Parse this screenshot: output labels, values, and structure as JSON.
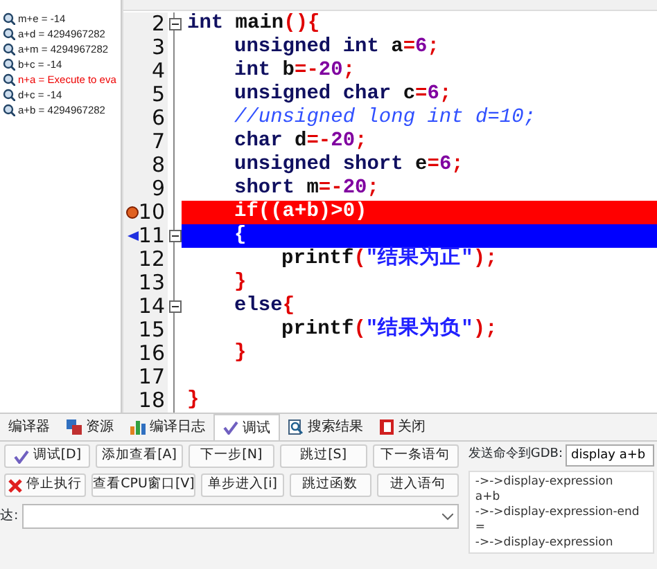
{
  "watches": [
    {
      "text": "m+e = -14",
      "error": false
    },
    {
      "text": "a+d = 4294967282",
      "error": false
    },
    {
      "text": "a+m = 4294967282",
      "error": false
    },
    {
      "text": "b+c = -14",
      "error": false
    },
    {
      "text": "n+a = Execute to eva",
      "error": true
    },
    {
      "text": "d+c = -14",
      "error": false
    },
    {
      "text": "a+b = 4294967282",
      "error": false
    }
  ],
  "editor": {
    "lines": [
      {
        "number": "2",
        "foldable": true,
        "breakpoint": false,
        "current": false,
        "tokens": [
          {
            "text": "int",
            "kind": "kw"
          },
          {
            "text": " main",
            "kind": "plain"
          },
          {
            "text": "(){",
            "kind": "sym"
          }
        ],
        "children": [
          {
            "number": "3",
            "foldable": false,
            "breakpoint": false,
            "current": false,
            "tokens": [
              {
                "text": "unsigned int",
                "kind": "kw"
              },
              {
                "text": " a",
                "kind": "plain"
              },
              {
                "text": "=",
                "kind": "sym"
              },
              {
                "text": "6",
                "kind": "num"
              },
              {
                "text": ";",
                "kind": "sym"
              }
            ]
          },
          {
            "number": "4",
            "foldable": false,
            "breakpoint": false,
            "current": false,
            "tokens": [
              {
                "text": "int",
                "kind": "kw"
              },
              {
                "text": " b",
                "kind": "plain"
              },
              {
                "text": "=-",
                "kind": "sym"
              },
              {
                "text": "20",
                "kind": "num"
              },
              {
                "text": ";",
                "kind": "sym"
              }
            ]
          },
          {
            "number": "5",
            "foldable": false,
            "breakpoint": false,
            "current": false,
            "tokens": [
              {
                "text": "unsigned char",
                "kind": "kw"
              },
              {
                "text": " c",
                "kind": "plain"
              },
              {
                "text": "=",
                "kind": "sym"
              },
              {
                "text": "6",
                "kind": "num"
              },
              {
                "text": ";",
                "kind": "sym"
              }
            ]
          },
          {
            "number": "6",
            "foldable": false,
            "breakpoint": false,
            "current": false,
            "tokens": [
              {
                "text": "//unsigned long int d=10;",
                "kind": "comment"
              }
            ]
          },
          {
            "number": "7",
            "foldable": false,
            "breakpoint": false,
            "current": false,
            "tokens": [
              {
                "text": "char",
                "kind": "kw"
              },
              {
                "text": " d",
                "kind": "plain"
              },
              {
                "text": "=-",
                "kind": "sym"
              },
              {
                "text": "20",
                "kind": "num"
              },
              {
                "text": ";",
                "kind": "sym"
              }
            ]
          },
          {
            "number": "8",
            "foldable": false,
            "breakpoint": false,
            "current": false,
            "tokens": [
              {
                "text": "unsigned short",
                "kind": "kw"
              },
              {
                "text": " e",
                "kind": "plain"
              },
              {
                "text": "=",
                "kind": "sym"
              },
              {
                "text": "6",
                "kind": "num"
              },
              {
                "text": ";",
                "kind": "sym"
              }
            ]
          },
          {
            "number": "9",
            "foldable": false,
            "breakpoint": false,
            "current": false,
            "tokens": [
              {
                "text": "short",
                "kind": "kw"
              },
              {
                "text": " m",
                "kind": "plain"
              },
              {
                "text": "=-",
                "kind": "sym"
              },
              {
                "text": "20",
                "kind": "num"
              },
              {
                "text": ";",
                "kind": "sym"
              }
            ]
          },
          {
            "number": "10",
            "foldable": false,
            "breakpoint": true,
            "current": false,
            "tokens": [
              {
                "text": "if((a+b)>0)",
                "kind": "plain"
              }
            ]
          },
          {
            "number": "11",
            "foldable": true,
            "breakpoint": false,
            "current": true,
            "tokens": [
              {
                "text": "{",
                "kind": "plain"
              }
            ],
            "children": [
              {
                "number": "12",
                "foldable": false,
                "breakpoint": false,
                "current": false,
                "tokens": [
                  {
                    "text": "printf",
                    "kind": "plain"
                  },
                  {
                    "text": "(",
                    "kind": "sym"
                  },
                  {
                    "text": "\"结果为正\"",
                    "kind": "str"
                  },
                  {
                    "text": ");",
                    "kind": "sym"
                  }
                ]
              }
            ]
          },
          {
            "number": "13",
            "foldable": false,
            "breakpoint": false,
            "current": false,
            "tokens": [
              {
                "text": "}",
                "kind": "sym"
              }
            ]
          },
          {
            "number": "14",
            "foldable": true,
            "breakpoint": false,
            "current": false,
            "tokens": [
              {
                "text": "else",
                "kind": "kw"
              },
              {
                "text": "{",
                "kind": "sym"
              }
            ],
            "children": [
              {
                "number": "15",
                "foldable": false,
                "breakpoint": false,
                "current": false,
                "tokens": [
                  {
                    "text": "printf",
                    "kind": "plain"
                  },
                  {
                    "text": "(",
                    "kind": "sym"
                  },
                  {
                    "text": "\"结果为负\"",
                    "kind": "str"
                  },
                  {
                    "text": ");",
                    "kind": "sym"
                  }
                ]
              }
            ]
          },
          {
            "number": "16",
            "foldable": false,
            "breakpoint": false,
            "current": false,
            "tokens": [
              {
                "text": "}",
                "kind": "sym"
              }
            ]
          }
        ]
      },
      {
        "number": "17",
        "foldable": false,
        "breakpoint": false,
        "current": false
      },
      {
        "number": "18",
        "foldable": false,
        "breakpoint": false,
        "current": false,
        "tokens": [
          {
            "text": "}",
            "kind": "sym"
          }
        ]
      }
    ]
  },
  "bottom_tabs": [
    {
      "label": "编译器",
      "selected": false
    },
    {
      "label": "资源",
      "selected": false
    },
    {
      "label": "编译日志",
      "selected": false
    },
    {
      "label": "调试",
      "selected": true
    },
    {
      "label": "搜索结果",
      "selected": false
    },
    {
      "label": "关闭",
      "selected": false
    }
  ],
  "debug_buttons": [
    "调试[D]",
    "添加查看[A]",
    "下一步[N]",
    "跳过[S]",
    "下一条语句",
    "停止执行",
    "查看CPU窗口[V]",
    "单步进入[i]",
    "跳过函数",
    "进入语句"
  ],
  "expression_label": "达:",
  "gdb": {
    "label": "发送命令到GDB:",
    "value": "display a+b",
    "output": [
      "->->display-expression",
      "a+b",
      "->->display-expression-end",
      "=",
      "->->display-expression"
    ]
  }
}
